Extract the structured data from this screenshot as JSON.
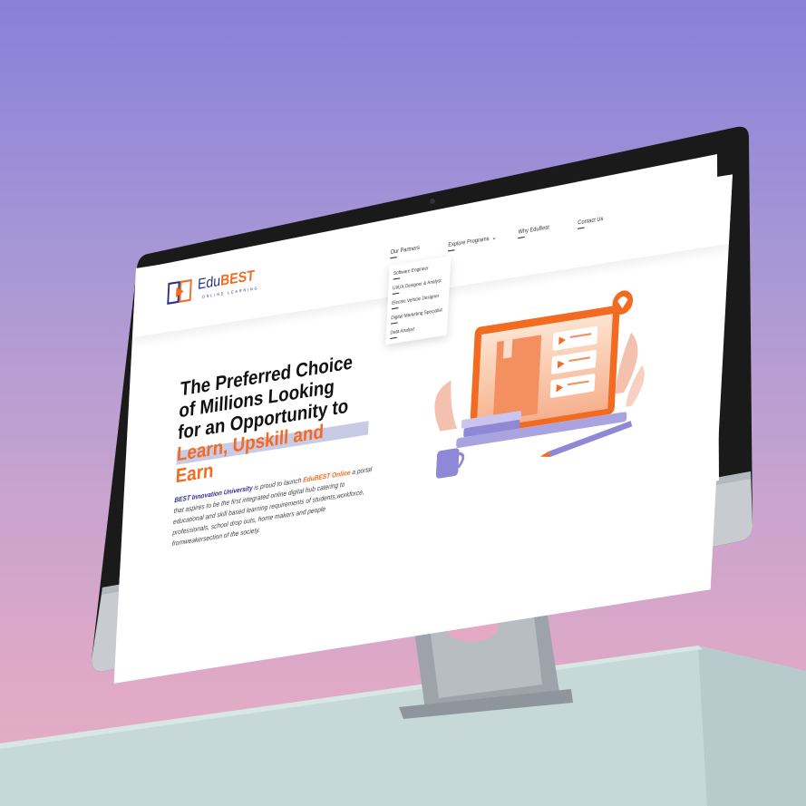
{
  "brand": {
    "name_part1": "Edu",
    "name_part2": "BEST",
    "tagline": "ONLINE LEARNING",
    "accent_color": "#f26b21",
    "primary_color": "#2b2f8a"
  },
  "nav": {
    "items": [
      {
        "label": "Our Partners"
      },
      {
        "label": "Explore Programs"
      },
      {
        "label": "Why EduBest"
      },
      {
        "label": "Contact Us"
      }
    ],
    "dropdown": [
      "Software Engineer",
      "UI/UX Designer & Analyst",
      "Electric Vehicle Designer",
      "Digital Marketing Specialist",
      "Data Analyst"
    ]
  },
  "hero": {
    "line1": "The Preferred Choice",
    "line2": "of Millions Looking",
    "line3": "for an Opportunity to",
    "accent1": "Learn, Upskill and",
    "accent2": "Earn",
    "desc_uni": "BEST Innovation University",
    "desc_mid": " is proud to launch ",
    "desc_brand": "EduBEST Online",
    "desc_rest": " a portal that aspires to be the first integrated online digital hub catering to educational and skill based learning requirements of students,workforce, professionals, school drop outs, home makers and people fromweakersection of the society."
  },
  "icons": {
    "logo": "book-play-logo-icon",
    "dropdown": "chevron-down-icon",
    "illustration": "laptop-learning-illustration",
    "device_logo": "apple-logo-icon"
  }
}
